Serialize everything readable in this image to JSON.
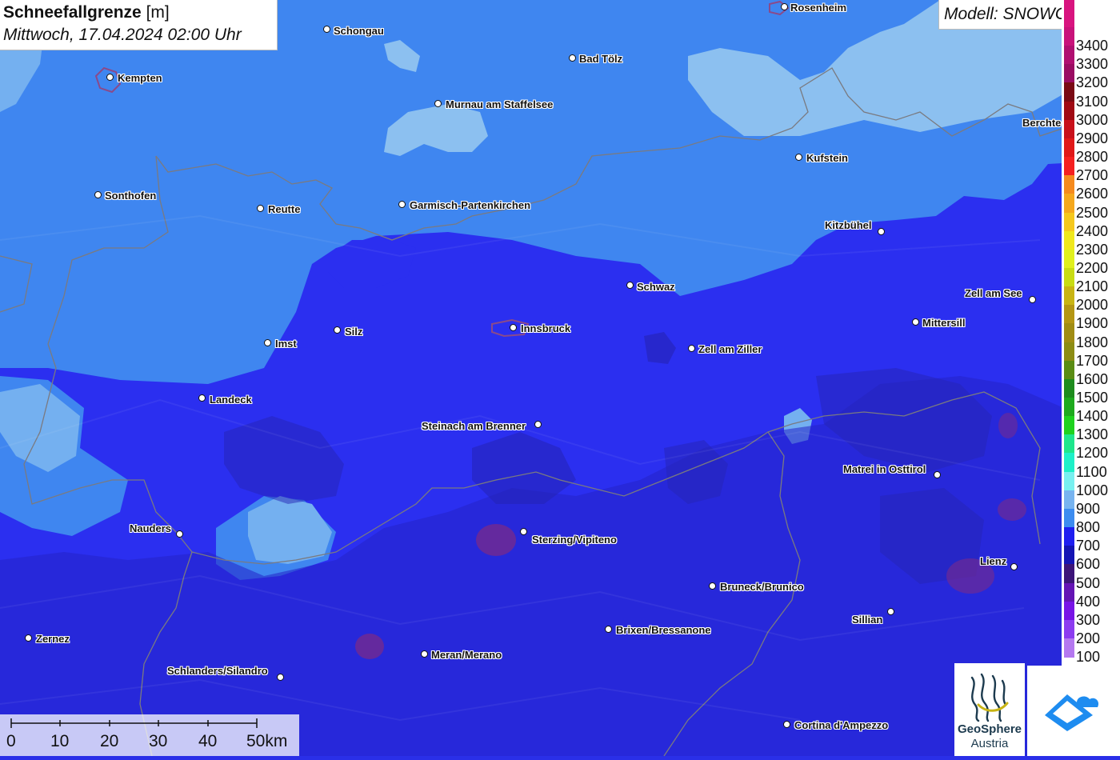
{
  "title": {
    "bold": "Schneefallgrenze",
    "unit": "[m]",
    "datetime": "Mittwoch, 17.04.2024 02:00 Uhr"
  },
  "model": "Modell: SNOWGRID",
  "legend": [
    {
      "label": "3400",
      "color": "#c8127a"
    },
    {
      "label": "3300",
      "color": "#b00f70"
    },
    {
      "label": "3200",
      "color": "#9a0c62"
    },
    {
      "label": "3100",
      "color": "#7a0a14"
    },
    {
      "label": "3000",
      "color": "#a00a14"
    },
    {
      "label": "2900",
      "color": "#c8101a"
    },
    {
      "label": "2800",
      "color": "#e01818"
    },
    {
      "label": "2700",
      "color": "#f52020"
    },
    {
      "label": "2600",
      "color": "#f58a1e"
    },
    {
      "label": "2500",
      "color": "#f5a81e"
    },
    {
      "label": "2400",
      "color": "#f5c81e"
    },
    {
      "label": "2300",
      "color": "#f0e81e"
    },
    {
      "label": "2200",
      "color": "#e0f01e"
    },
    {
      "label": "2100",
      "color": "#c8dc14"
    },
    {
      "label": "2000",
      "color": "#c8b414"
    },
    {
      "label": "1900",
      "color": "#b49614"
    },
    {
      "label": "1800",
      "color": "#a08c14"
    },
    {
      "label": "1700",
      "color": "#8c8c14"
    },
    {
      "label": "1600",
      "color": "#5a8c14"
    },
    {
      "label": "1500",
      "color": "#1e8c1e"
    },
    {
      "label": "1400",
      "color": "#1eaa1e"
    },
    {
      "label": "1300",
      "color": "#1ed21e"
    },
    {
      "label": "1200",
      "color": "#1ee68c"
    },
    {
      "label": "1100",
      "color": "#1ef0c8"
    },
    {
      "label": "1000",
      "color": "#78f0f0"
    },
    {
      "label": "900",
      "color": "#78b4f0"
    },
    {
      "label": "800",
      "color": "#3c8cf0"
    },
    {
      "label": "700",
      "color": "#1e1ef0"
    },
    {
      "label": "600",
      "color": "#1414b4"
    },
    {
      "label": "500",
      "color": "#3c1478"
    },
    {
      "label": "400",
      "color": "#6414b4"
    },
    {
      "label": "300",
      "color": "#7814e6"
    },
    {
      "label": "200",
      "color": "#8c3cf0"
    },
    {
      "label": "100",
      "color": "#b478f0"
    }
  ],
  "places": [
    {
      "name": "Rosenheim"
    },
    {
      "name": "Schongau"
    },
    {
      "name": "Kempten"
    },
    {
      "name": "Bad Tölz"
    },
    {
      "name": "Murnau am Staffelsee"
    },
    {
      "name": "Berchte"
    },
    {
      "name": "Kufstein"
    },
    {
      "name": "Sonthofen"
    },
    {
      "name": "Reutte"
    },
    {
      "name": "Garmisch-Partenkirchen"
    },
    {
      "name": "Kitzbühel"
    },
    {
      "name": "Schwaz"
    },
    {
      "name": "Zell am See"
    },
    {
      "name": "Mittersill"
    },
    {
      "name": "Imst"
    },
    {
      "name": "Silz"
    },
    {
      "name": "Innsbruck"
    },
    {
      "name": "Zell am Ziller"
    },
    {
      "name": "Landeck"
    },
    {
      "name": "Steinach am Brenner"
    },
    {
      "name": "Matrei in Osttirol"
    },
    {
      "name": "Nauders"
    },
    {
      "name": "Sterzing/Vipiteno"
    },
    {
      "name": "Lienz"
    },
    {
      "name": "Bruneck/Brunico"
    },
    {
      "name": "Sillian"
    },
    {
      "name": "Brixen/Bressanone"
    },
    {
      "name": "Zernez"
    },
    {
      "name": "Meran/Merano"
    },
    {
      "name": "Schlanders/Silandro"
    },
    {
      "name": "Cortina d'Ampezzo"
    }
  ],
  "scale_ticks": [
    "0",
    "10",
    "20",
    "30",
    "40",
    "50km"
  ],
  "logos": {
    "geosphere_name": "GeoSphere",
    "geosphere_sub": "Austria"
  }
}
